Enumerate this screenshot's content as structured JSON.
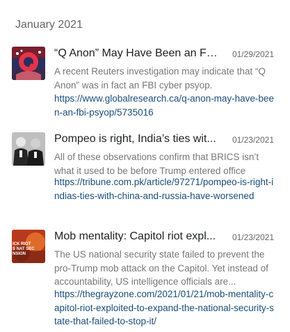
{
  "month_heading": "January 2021",
  "articles": [
    {
      "title": "“Q Anon” May Have Been an FB...",
      "date": "01/29/2021",
      "snippet": "A recent Reuters investigation may indicate that “Q Anon” was in fact an FBI cyber psyop.",
      "url": "https://www.globalresearch.ca/q-anon-may-have-been-an-fbi-psyop/5735016",
      "thumb_icon": "q-anon-thumbnail"
    },
    {
      "title": "Pompeo is right, India’s ties wit...",
      "date": "01/23/2021",
      "snippet": "All of these observations confirm that BRICS isn’t what it used to be before Trump entered office",
      "url": "https://tribune.com.pk/article/97271/pompeo-is-right-indias-ties-with-china-and-russia-have-worsened",
      "thumb_icon": "leaders-photo-thumbnail"
    },
    {
      "title": "Mob mentality: Capitol riot expl...",
      "date": "01/23/2021",
      "snippet": "The US national security state failed to prevent the pro-Trump mob attack on the Capitol. Yet instead of accountability, US intelligence officials are...",
      "url": "https://thegrayzone.com/2021/01/21/mob-mentality-capitol-riot-exploited-to-expand-the-national-security-state-that-failed-to-stop-it/",
      "thumb_icon": "capitol-riot-thumbnail",
      "thumb_text": "ICK RIOT\nS NAT SEC\nNSION"
    }
  ]
}
